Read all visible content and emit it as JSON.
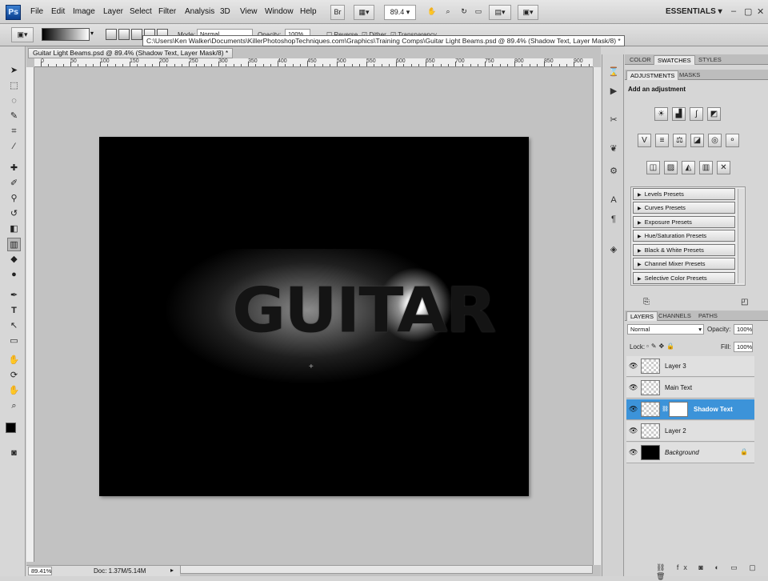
{
  "app": {
    "logo": "Ps"
  },
  "menu": [
    "File",
    "Edit",
    "Image",
    "Layer",
    "Select",
    "Filter",
    "Analysis",
    "3D",
    "View",
    "Window",
    "Help"
  ],
  "toolbar": {
    "zoom": "89.4",
    "workspace": "ESSENTIALS"
  },
  "options": {
    "mode_label": "Mode:",
    "mode_value": "Normal",
    "opacity_label": "Opacity:",
    "opacity_value": "100%",
    "reverse": "Reverse",
    "dither": "Dither",
    "transparency": "Transparency"
  },
  "tooltip": "C:\\Users\\Ken Walker\\Documents\\KillerPhotoshopTechniques.com\\Graphics\\Training Comps\\Guitar Light Beams.psd @ 89.4% (Shadow Text, Layer Mask/8) *",
  "document": {
    "tab_title": "Guitar Light Beams.psd @ 89.4% (Shadow Text, Layer Mask/8) *",
    "canvas_text": "GUITAR"
  },
  "ruler": [
    "0",
    "50",
    "100",
    "150",
    "200",
    "250",
    "300",
    "350",
    "400",
    "450",
    "500",
    "550",
    "600",
    "650",
    "700",
    "750",
    "800",
    "850",
    "900"
  ],
  "status": {
    "zoom": "89.41%",
    "doc": "Doc: 1.37M/5.14M"
  },
  "panels": {
    "top_tabs": [
      "COLOR",
      "SWATCHES",
      "STYLES"
    ],
    "adj_tabs": [
      "ADJUSTMENTS",
      "MASKS"
    ],
    "adj_title": "Add an adjustment",
    "presets": [
      "Levels Presets",
      "Curves Presets",
      "Exposure Presets",
      "Hue/Saturation Presets",
      "Black & White Presets",
      "Channel Mixer Presets",
      "Selective Color Presets"
    ],
    "layer_tabs": [
      "LAYERS",
      "CHANNELS",
      "PATHS"
    ]
  },
  "layers": {
    "blend": "Normal",
    "opacity_label": "Opacity:",
    "opacity": "100%",
    "lock_label": "Lock:",
    "fill_label": "Fill:",
    "fill": "100%",
    "items": [
      {
        "name": "Layer 3"
      },
      {
        "name": "Main Text"
      },
      {
        "name": "Shadow Text"
      },
      {
        "name": "Layer 2"
      },
      {
        "name": "Background"
      }
    ]
  }
}
